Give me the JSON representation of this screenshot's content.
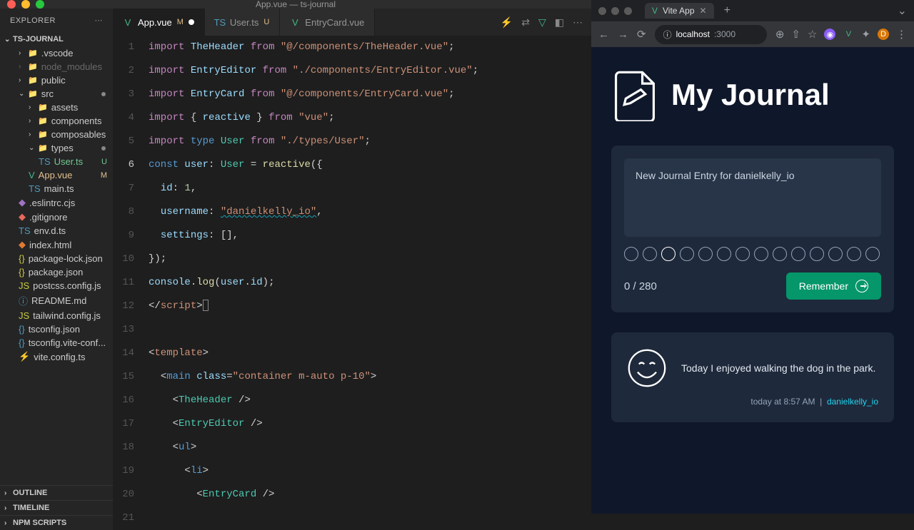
{
  "vscode": {
    "window_title": "App.vue — ts-journal",
    "explorer_label": "EXPLORER",
    "project_name": "TS-JOURNAL",
    "tree": {
      "vscode_folder": ".vscode",
      "node_modules": "node_modules",
      "public": "public",
      "src": "src",
      "assets": "assets",
      "components": "components",
      "composables": "composables",
      "types": "types",
      "user_ts": "User.ts",
      "app_vue": "App.vue",
      "main_ts": "main.ts",
      "eslintrc": ".eslintrc.cjs",
      "gitignore": ".gitignore",
      "env_d_ts": "env.d.ts",
      "index_html": "index.html",
      "package_lock": "package-lock.json",
      "package_json": "package.json",
      "postcss": "postcss.config.js",
      "readme": "README.md",
      "tailwind": "tailwind.config.js",
      "tsconfig": "tsconfig.json",
      "tsconfig_vite": "tsconfig.vite-conf...",
      "vite_config": "vite.config.ts"
    },
    "sections": {
      "outline": "OUTLINE",
      "timeline": "TIMELINE",
      "npm": "NPM SCRIPTS"
    },
    "tabs": [
      {
        "name": "App.vue",
        "status": "M",
        "active": true,
        "dirty": true
      },
      {
        "name": "User.ts",
        "status": "U",
        "active": false
      },
      {
        "name": "EntryCard.vue",
        "status": "",
        "active": false
      }
    ],
    "code": {
      "line_start": 1,
      "active_line": 6
    }
  },
  "browser": {
    "tab_title": "Vite App",
    "url_domain": "localhost",
    "url_port": ":3000"
  },
  "app": {
    "title": "My Journal",
    "entry_placeholder": "New Journal Entry for danielkelly_io",
    "char_count": "0 / 280",
    "remember_label": "Remember",
    "entry": {
      "text": "Today I enjoyed walking the dog in the park.",
      "time": "today at 8:57 AM",
      "separator": "|",
      "user": "danielkelly_io"
    }
  },
  "chart_data": null
}
